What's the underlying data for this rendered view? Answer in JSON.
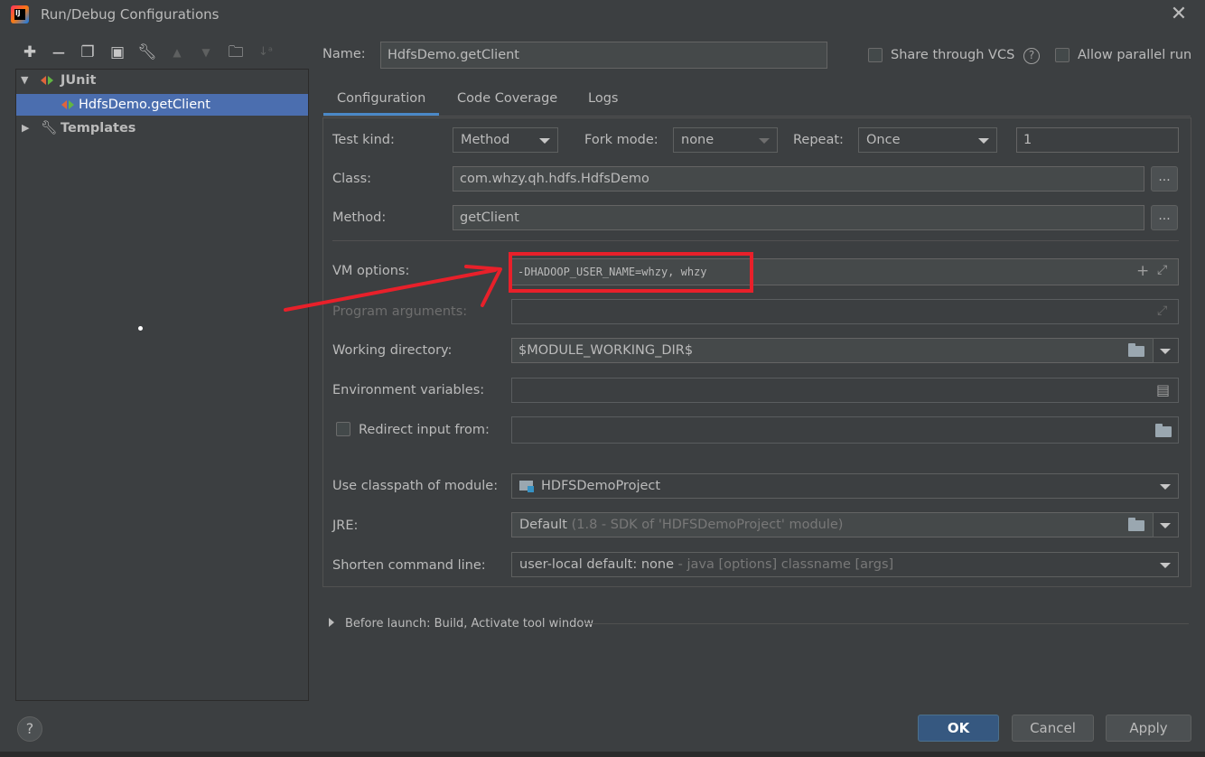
{
  "window": {
    "title": "Run/Debug Configurations",
    "app_icon_text": "IJ"
  },
  "toolbar": {
    "buttons": [
      "add",
      "remove",
      "copy",
      "save",
      "edit-defaults",
      "move-up",
      "move-down",
      "new-folder",
      "sort"
    ]
  },
  "tree": {
    "junit_label": "JUnit",
    "selected_item": "HdfsDemo.getClient",
    "templates_label": "Templates"
  },
  "header": {
    "name_label": "Name:",
    "name_value": "HdfsDemo.getClient",
    "share_label": "Share through VCS",
    "share_checked": false,
    "parallel_label": "Allow parallel run",
    "parallel_checked": false
  },
  "tabs": [
    {
      "label": "Configuration",
      "active": true
    },
    {
      "label": "Code Coverage",
      "active": false
    },
    {
      "label": "Logs",
      "active": false
    }
  ],
  "config": {
    "test_kind_label": "Test kind:",
    "test_kind_value": "Method",
    "fork_mode_label": "Fork mode:",
    "fork_mode_value": "none",
    "repeat_label": "Repeat:",
    "repeat_value": "Once",
    "repeat_count": "1",
    "class_label": "Class:",
    "class_value": "com.whzy.qh.hdfs.HdfsDemo",
    "method_label": "Method:",
    "method_value": "getClient",
    "browse_label": "...",
    "vm_options_label": "VM options:",
    "vm_options_value": "-DHADOOP_USER_NAME=whzy, whzy",
    "program_args_label": "Program arguments:",
    "program_args_value": "",
    "working_dir_label": "Working directory:",
    "working_dir_value": "$MODULE_WORKING_DIR$",
    "env_vars_label": "Environment variables:",
    "env_vars_value": "",
    "redirect_label": "Redirect input from:",
    "redirect_checked": false,
    "redirect_value": "",
    "classpath_label": "Use classpath of module:",
    "classpath_value": "HDFSDemoProject",
    "jre_label": "JRE:",
    "jre_value": "Default",
    "jre_detail": "(1.8 - SDK of 'HDFSDemoProject' module)",
    "shorten_label": "Shorten command line:",
    "shorten_value": "user-local default: none",
    "shorten_detail": "- java [options] classname [args]"
  },
  "before_launch": {
    "label": "Before launch: Build, Activate tool window"
  },
  "footer": {
    "help": "?",
    "ok": "OK",
    "cancel": "Cancel",
    "apply": "Apply"
  },
  "colors": {
    "background": "#3c3f41",
    "selection": "#4b6eaf",
    "primary_button": "#365880",
    "annotation_red": "#e8202a"
  }
}
